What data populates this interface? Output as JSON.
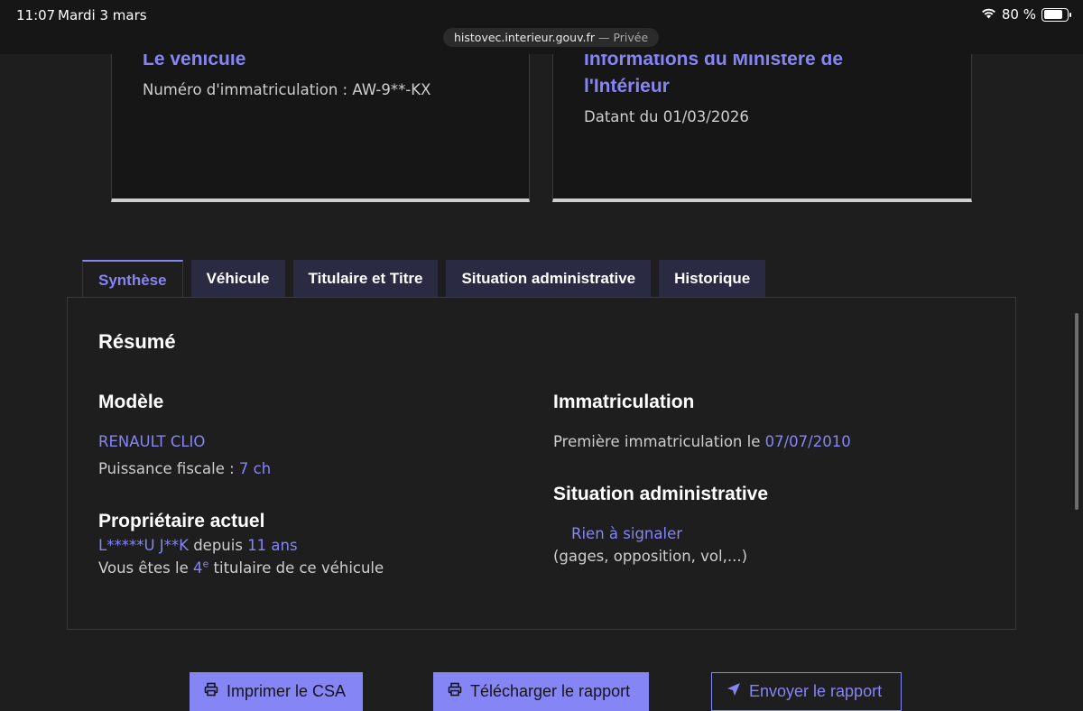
{
  "status_bar": {
    "time": "11:07",
    "date": "Mardi 3 mars",
    "battery": "80 %",
    "battery_level": 0.8
  },
  "browser": {
    "url": "histovec.interieur.gouv.fr",
    "mode": "— Privée"
  },
  "cards": {
    "vehicle": {
      "title": "Le véhicule",
      "plate_label": "Numéro d'immatriculation : AW-9**-KX"
    },
    "ministry": {
      "title_line1": "Informations du Ministère de",
      "title_line2": "l'Intérieur",
      "date_label": "Datant du 01/03/2026"
    }
  },
  "tabs": [
    "Synthèse",
    "Véhicule",
    "Titulaire et Titre",
    "Situation administrative",
    "Historique"
  ],
  "summary": {
    "title": "Résumé",
    "model": {
      "heading": "Modèle",
      "name": "RENAULT CLIO",
      "power_label": "Puissance fiscale : ",
      "power_value": "7 ch"
    },
    "owner": {
      "heading": "Propriétaire actuel",
      "name": "L*****U J**K",
      "since_label": " depuis ",
      "since_value": "11 ans",
      "rank_prefix": "Vous êtes le ",
      "rank_num": "4",
      "rank_sup": "e",
      "rank_suffix": " titulaire de ce véhicule"
    },
    "registration": {
      "heading": "Immatriculation",
      "label": "Première immatriculation le ",
      "date": "07/07/2010"
    },
    "admin": {
      "heading": "Situation administrative",
      "status": "Rien à signaler",
      "note": "(gages, opposition, vol,...)"
    }
  },
  "actions": {
    "print": "Imprimer le CSA",
    "download": "Télécharger le rapport",
    "send": "Envoyer le rapport"
  },
  "colors": {
    "accent": "#8585f6",
    "background": "#1e1e1e",
    "tab_bg": "#2a2a43"
  }
}
